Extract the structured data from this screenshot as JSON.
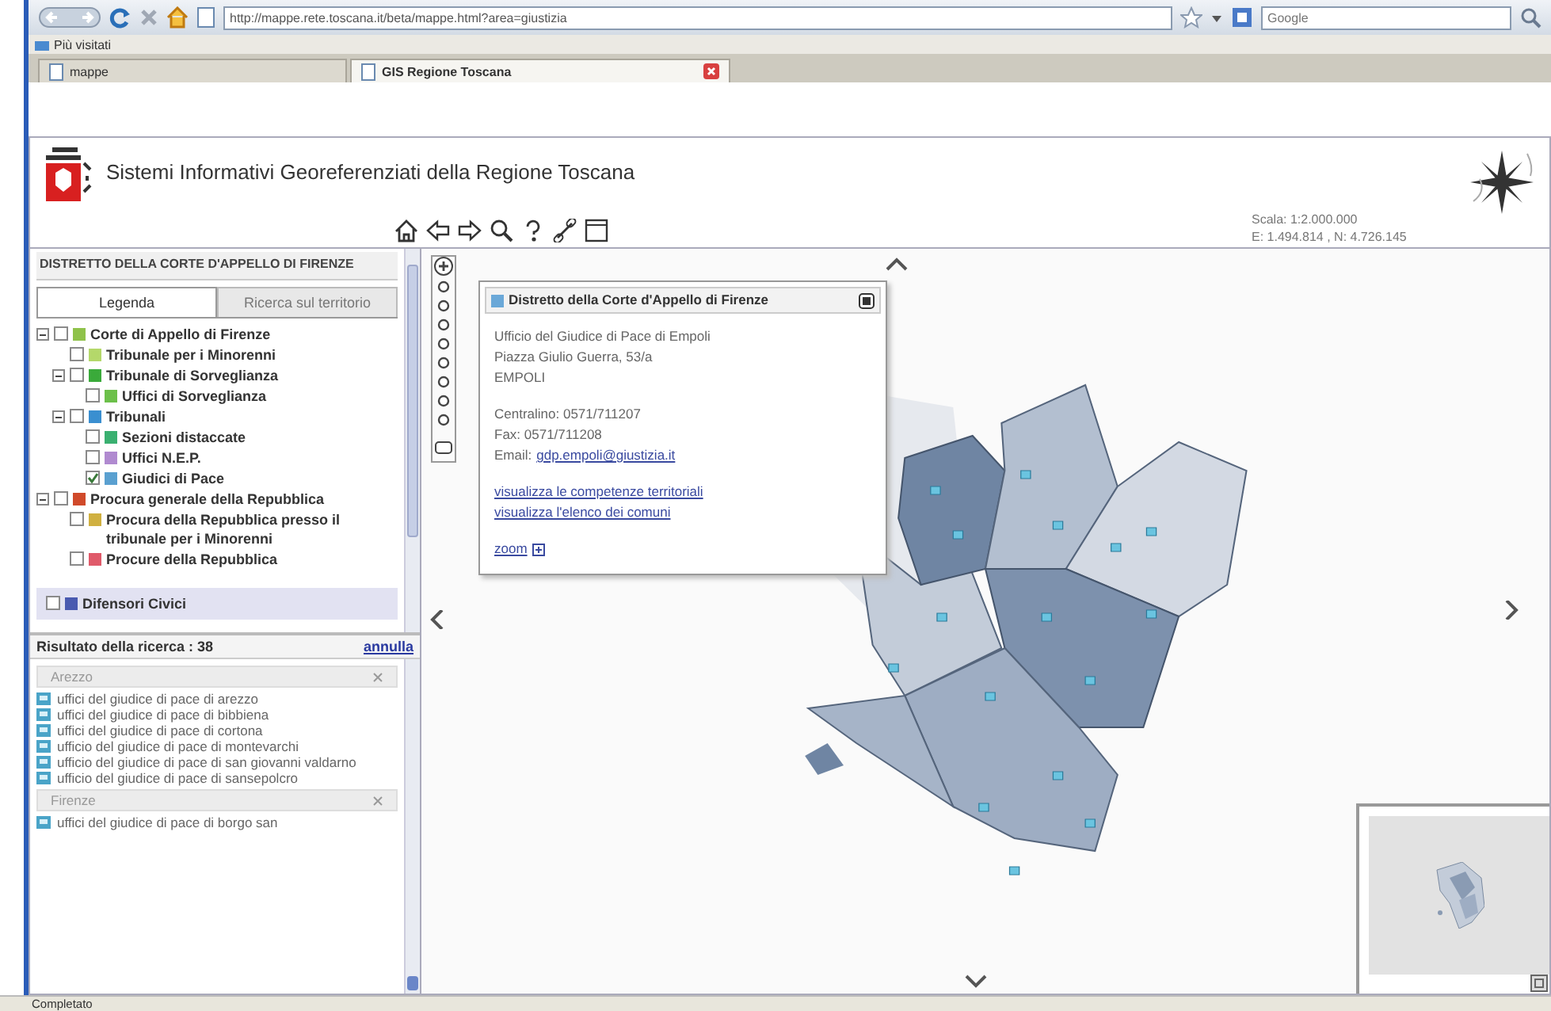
{
  "browser": {
    "url": "http://mappe.rete.toscana.it/beta/mappe.html?area=giustizia",
    "search": {
      "placeholder": "Google"
    },
    "bookmarks": [
      "Più visitati"
    ],
    "tabs": [
      {
        "label": "mappe",
        "selected": false
      },
      {
        "label": "GIS Regione Toscana",
        "selected": true
      }
    ]
  },
  "header": {
    "title": "Sistemi Informativi Georeferenziati della Regione Toscana",
    "scale": "Scala: 1:2.000.000",
    "coordinates": "E: 1.494.814 , N: 4.726.145"
  },
  "panel": {
    "heading": "DISTRETTO DELLA CORTE D'APPELLO DI FIRENZE",
    "tabs": [
      {
        "label": "Legenda",
        "selected": true
      },
      {
        "label": "Ricerca sul territorio",
        "selected": false
      }
    ],
    "legend": [
      {
        "label": "Corte di Appello di Firenze",
        "checked": false,
        "color": "#8fc24a",
        "expanded": true,
        "children": [
          {
            "label": "Tribunale per i Minorenni",
            "checked": false,
            "color": "#b4d86a"
          },
          {
            "label": "Tribunale di Sorveglianza",
            "checked": false,
            "color": "#3aaa3a",
            "expanded": true,
            "children": [
              {
                "label": "Uffici di Sorveglianza",
                "checked": false,
                "color": "#6cc04a"
              }
            ]
          },
          {
            "label": "Tribunali",
            "checked": false,
            "color": "#3a8fd0",
            "expanded": true,
            "children": [
              {
                "label": "Sezioni distaccate",
                "checked": false,
                "color": "#3ab070"
              },
              {
                "label": "Uffici N.E.P.",
                "checked": false,
                "color": "#b08ad0"
              },
              {
                "label": "Giudici di Pace",
                "checked": true,
                "color": "#5aa0d0"
              }
            ]
          }
        ]
      },
      {
        "label": "Procura generale della Repubblica",
        "checked": false,
        "color": "#d04a2a",
        "expanded": true,
        "children": [
          {
            "label": "Procura della Repubblica presso il tribunale per i Minorenni",
            "checked": false,
            "color": "#d0b040"
          },
          {
            "label": "Procure della Repubblica",
            "checked": false,
            "color": "#e05a6a"
          }
        ]
      }
    ],
    "extra_layer": {
      "label": "Difensori Civici",
      "checked": false,
      "color": "#4a5ab0"
    },
    "results": {
      "title": "Risultato della ricerca : 38",
      "action": "annulla",
      "groups": [
        {
          "name": "Arezzo",
          "items": [
            "uffici del giudice di pace di arezzo",
            "uffici del giudice di pace di bibbiena",
            "uffici del giudice di pace di cortona",
            "ufficio del giudice di pace di montevarchi",
            "ufficio del giudice di pace di san giovanni valdarno",
            "ufficio del giudice di pace di sansepolcro"
          ]
        },
        {
          "name": "Firenze",
          "items": [
            "uffici del giudice di pace di borgo san"
          ]
        }
      ]
    }
  },
  "popup": {
    "title": "Distretto della Corte d'Appello di Firenze",
    "lines": [
      "Ufficio del Giudice di Pace di Empoli",
      "Piazza Giulio Guerra, 53/a",
      "EMPOLI"
    ],
    "contacts": [
      "Centralino: 0571/711207",
      "Fax: 0571/711208"
    ],
    "email": {
      "label": "Email:",
      "address": "gdp.empoli@giustizia.it"
    },
    "links": [
      "visualizza le competenze territoriali",
      "visualizza l'elenco dei comuni"
    ],
    "zoom": "zoom"
  },
  "status_bar": {
    "text": "Completato"
  }
}
